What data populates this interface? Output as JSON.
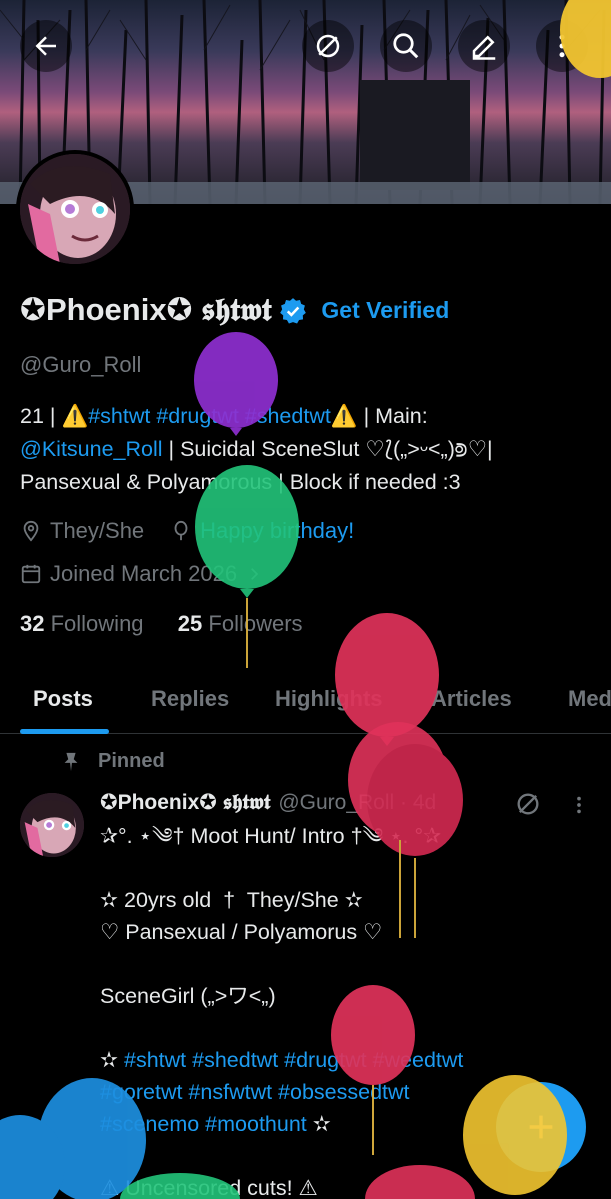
{
  "profile": {
    "display_name": "✪Phoenix✪ 𝖘𝖍𝖙𝖜𝖙",
    "get_verified": "Get Verified",
    "handle": "@Guro_Roll",
    "bio_line1": "21 | ⚠️",
    "bio_tags1": "#shtwt #drugtwt #shedtwt",
    "bio_line1_end": "⚠️ | Main:",
    "bio_mention": "@Kitsune_Roll",
    "bio_line2": " | Suicidal SceneSlut ♡⟅(„>ᵕ<„)⟄♡|",
    "bio_line3": "Pansexual & Polyamorous | Block if needed :3",
    "pronouns": "They/She",
    "birthday": "Happy birthday!",
    "joined": "Joined March 2026",
    "following_count": "32",
    "following_label": "Following",
    "followers_count": "25",
    "followers_label": "Followers"
  },
  "tabs": [
    "Posts",
    "Replies",
    "Highlights",
    "Articles",
    "Media"
  ],
  "pinned": {
    "label": "Pinned",
    "author": "✪Phoenix✪ 𝖘𝖍𝖙𝖜𝖙",
    "handle": "@Guro_Roll · 4d",
    "line1": "✰°. ⋆༄† Moot Hunt/ Intro †༄ ⋆. °✰",
    "line2": "✫ 20yrs old  †  They/She ✫",
    "line3": "♡ Pansexual / Polyamorus ♡",
    "line4": "SceneGirl („>ワ<„)",
    "line5_star": "✫ ",
    "tags1": "#shtwt #shedtwt #drugtwt #weedtwt",
    "tags2": "#goretwt #nsfwtwt #obsessedtwt",
    "tags3": "#scenemo #moothunt",
    "line6": "⚠ Uncensored cuts! ⚠"
  },
  "icons": [
    "back-arrow-icon",
    "grok-icon",
    "search-icon",
    "edit-icon",
    "more-icon",
    "location-icon",
    "balloon-icon",
    "calendar-icon",
    "pin-icon",
    "plus-icon"
  ],
  "colors": {
    "accent": "#1d9bf0",
    "muted": "#71767b",
    "text": "#e7e9ea",
    "background": "#000000"
  }
}
